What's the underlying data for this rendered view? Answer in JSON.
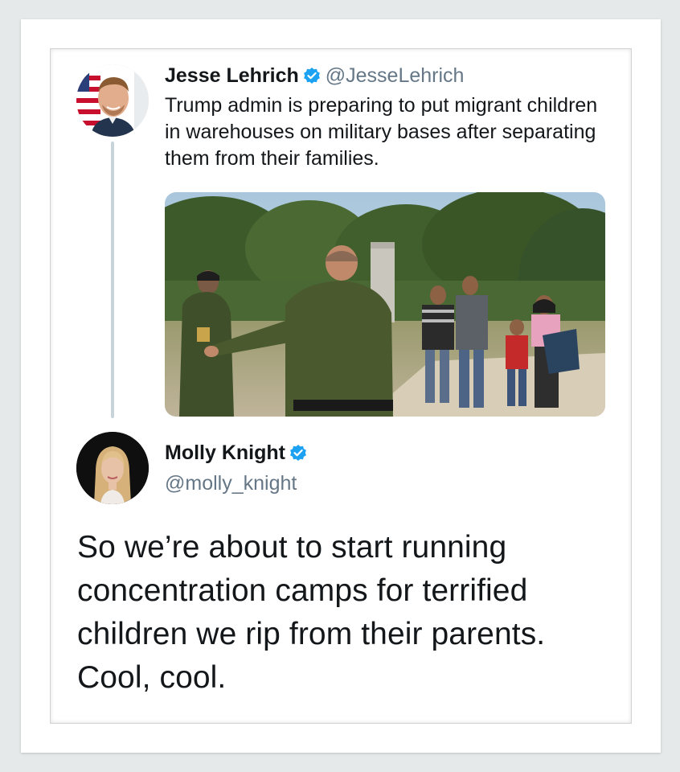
{
  "tweet1": {
    "name": "Jesse Lehrich",
    "handle": "@JesseLehrich",
    "text": "Trump admin is preparing to put migrant children in warehouses on military bases after separating them from their families.",
    "avatar_icon": "profile-photo",
    "verified_color": "#1da1f2"
  },
  "tweet2": {
    "name": "Molly Knight",
    "handle": "@molly_knight",
    "text": "So we’re about to start running concentration camps for terrified children we rip from their parents. Cool, cool.",
    "avatar_icon": "profile-photo",
    "verified_color": "#1da1f2"
  },
  "media": {
    "description_icon": "photo-border-patrol-agents-and-migrants"
  },
  "colors": {
    "handle": "#657786",
    "text": "#14171a",
    "thread_line": "#c9d3da"
  }
}
